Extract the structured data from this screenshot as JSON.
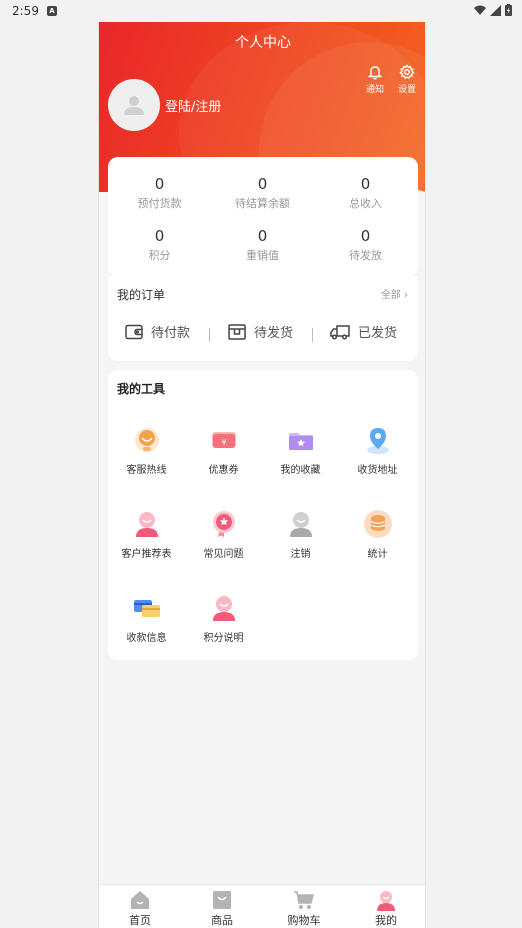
{
  "status_bar": {
    "time": "2:59",
    "notification_icon": "A"
  },
  "header": {
    "title": "个人中心",
    "login_text": "登陆/注册",
    "notify_label": "通知",
    "settings_label": "设置"
  },
  "stats": [
    {
      "value": "0",
      "label": "预付货款"
    },
    {
      "value": "0",
      "label": "待结算余额"
    },
    {
      "value": "0",
      "label": "总收入"
    },
    {
      "value": "0",
      "label": "积分"
    },
    {
      "value": "0",
      "label": "重销值"
    },
    {
      "value": "0",
      "label": "待发放"
    }
  ],
  "orders": {
    "title": "我的订单",
    "all_label": "全部",
    "items": [
      {
        "label": "待付款",
        "icon": "wallet-icon"
      },
      {
        "label": "待发货",
        "icon": "box-icon"
      },
      {
        "label": "已发货",
        "icon": "truck-icon"
      }
    ]
  },
  "tools": {
    "title": "我的工具",
    "items": [
      {
        "label": "客服热线",
        "icon": "customer-service-icon",
        "color": "#f5a14a"
      },
      {
        "label": "优惠券",
        "icon": "coupon-icon",
        "color": "#f5707a"
      },
      {
        "label": "我的收藏",
        "icon": "favorites-folder-icon",
        "color": "#b08cf0"
      },
      {
        "label": "收货地址",
        "icon": "location-pin-icon",
        "color": "#5aa9f5"
      },
      {
        "label": "客户推荐表",
        "icon": "referral-user-icon",
        "color": "#f35a78"
      },
      {
        "label": "常见问题",
        "icon": "faq-badge-icon",
        "color": "#f35a78"
      },
      {
        "label": "注销",
        "icon": "logout-user-icon",
        "color": "#a9a9a9"
      },
      {
        "label": "统计",
        "icon": "statistics-coins-icon",
        "color": "#f2a55a"
      },
      {
        "label": "收款信息",
        "icon": "payment-card-icon",
        "color": "#4f8df5"
      },
      {
        "label": "积分说明",
        "icon": "points-info-icon",
        "color": "#f35a78"
      }
    ]
  },
  "tabbar": {
    "items": [
      {
        "label": "首页",
        "icon": "home-icon",
        "active": false
      },
      {
        "label": "商品",
        "icon": "shopping-bag-icon",
        "active": false
      },
      {
        "label": "购物车",
        "icon": "cart-icon",
        "active": false
      },
      {
        "label": "我的",
        "icon": "profile-icon",
        "active": true
      }
    ]
  },
  "colors": {
    "brand_red": "#e8262a",
    "brand_orange": "#f4651f",
    "inactive_icon": "#b3b3b3",
    "active_icon": "#f35a78"
  }
}
